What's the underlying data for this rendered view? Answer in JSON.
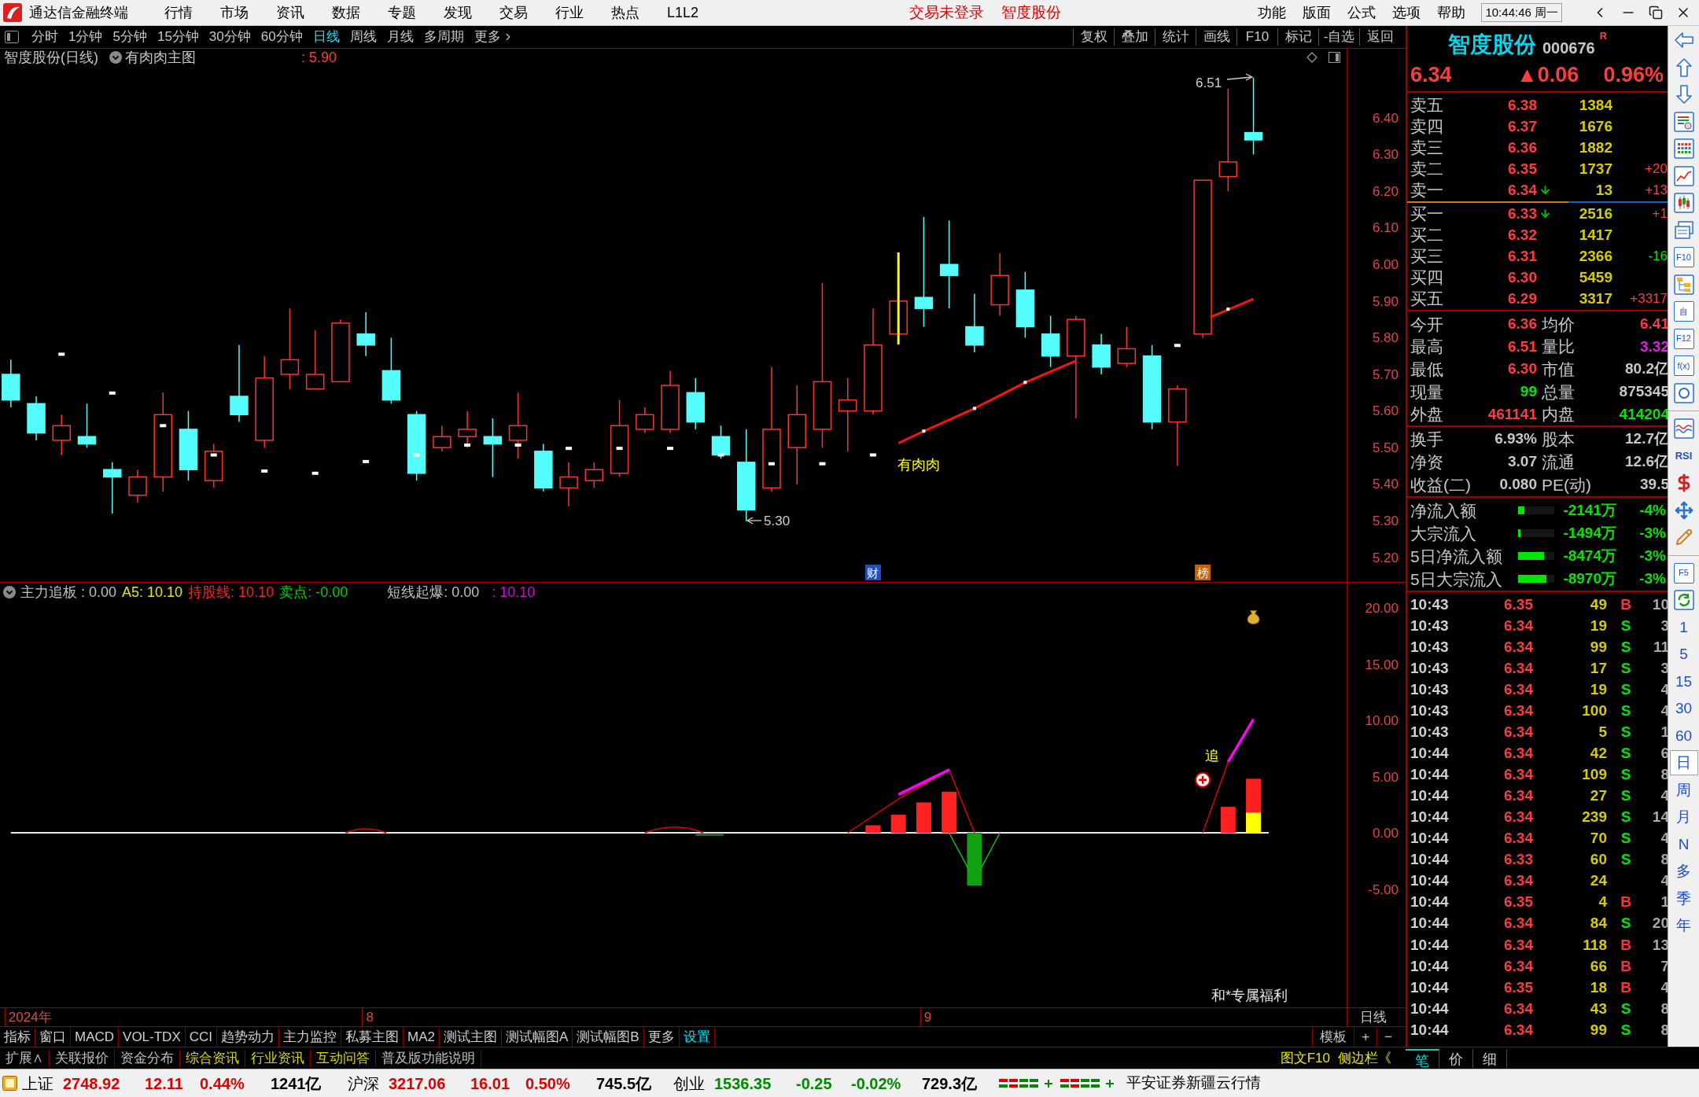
{
  "menu_bar": {
    "app_title": "通达信金融终端",
    "menus": [
      "行情",
      "市场",
      "资讯",
      "数据",
      "专题",
      "发现",
      "交易",
      "行业",
      "热点",
      "L1L2"
    ],
    "notices": [
      "交易未登录",
      "智度股份"
    ],
    "right_menus": [
      "功能",
      "版面",
      "公式",
      "选项",
      "帮助"
    ],
    "clock": "10:44:46 周一"
  },
  "period_bar": {
    "periods": [
      {
        "label": "分时",
        "selected": false,
        "kind": "period"
      },
      {
        "label": "1分钟",
        "selected": false,
        "kind": "period"
      },
      {
        "label": "5分钟",
        "selected": false,
        "kind": "period"
      },
      {
        "label": "15分钟",
        "selected": false,
        "kind": "period"
      },
      {
        "label": "30分钟",
        "selected": false,
        "kind": "period"
      },
      {
        "label": "60分钟",
        "selected": false,
        "kind": "period"
      },
      {
        "label": "日线",
        "selected": true,
        "kind": "period"
      },
      {
        "label": "周线",
        "selected": false,
        "kind": "period"
      },
      {
        "label": "月线",
        "selected": false,
        "kind": "period"
      },
      {
        "label": "多周期",
        "selected": false,
        "kind": "period"
      },
      {
        "label": "更多",
        "selected": false,
        "kind": "menu"
      }
    ],
    "tools": [
      "复权",
      "叠加",
      "统计",
      "画线",
      "F10",
      "标记",
      "-自选",
      "返回"
    ]
  },
  "main_chart": {
    "title": "智度股份(日线)",
    "template": "有肉肉主图",
    "reading": ": 5.90",
    "price_axis": [
      "6.40",
      "6.30",
      "6.20",
      "6.10",
      "6.00",
      "5.90",
      "5.80",
      "5.70",
      "5.60",
      "5.50",
      "5.40",
      "5.30",
      "5.20"
    ],
    "high_label": "6.51",
    "low_label": "5.30",
    "line_label": "有肉肉",
    "markers": [
      {
        "text": "财",
        "kind": "finance"
      },
      {
        "text": "榜",
        "kind": "ranking"
      }
    ]
  },
  "indicator_chart": {
    "readings": [
      {
        "text": "主力追板 : 0.00",
        "color": "#c0c0c0"
      },
      {
        "text": "A5: 10.10",
        "color": "#e6e600"
      },
      {
        "text": "持股线: 10.10",
        "color": "#ff2020"
      },
      {
        "text": "卖点: -0.00",
        "color": "#00d000"
      },
      {
        "text": "短线起爆: 0.00",
        "color": "#c0c0c0"
      },
      {
        "text": ": 10.10",
        "color": "#e000e0"
      }
    ],
    "axis": [
      "20.00",
      "15.00",
      "10.00",
      "5.00",
      "0.00",
      "-5.00"
    ],
    "signal": "追",
    "promo": "和*专属福利"
  },
  "date_axis": {
    "labels": [
      "2024年",
      "8",
      "9"
    ],
    "period": "日线"
  },
  "toolbar": {
    "tabs": [
      {
        "label": "指标",
        "selected": false
      },
      {
        "label": "窗口",
        "selected": false
      },
      {
        "label": "MACD",
        "selected": false
      },
      {
        "label": "VOL-TDX",
        "selected": false
      },
      {
        "label": "CCI",
        "selected": false
      },
      {
        "label": "趋势动力",
        "selected": false
      },
      {
        "label": "主力监控",
        "selected": false
      },
      {
        "label": "私募主图",
        "selected": false
      },
      {
        "label": "MA2",
        "selected": false
      },
      {
        "label": "测试主图",
        "selected": false
      },
      {
        "label": "测试幅图A",
        "selected": false
      },
      {
        "label": "测试幅图B",
        "selected": false
      },
      {
        "label": "更多",
        "selected": false
      },
      {
        "label": "设置",
        "selected": true
      }
    ],
    "tools": [
      "模板",
      "+",
      "−"
    ]
  },
  "info_bar": {
    "links": [
      {
        "label": "扩展∧",
        "color": "#c0c0c0"
      },
      {
        "label": "关联报价",
        "color": "#c0c0c0"
      },
      {
        "label": "资金分布",
        "color": "#c0c0c0"
      },
      {
        "label": "综合资讯",
        "color": "#d8d800"
      },
      {
        "label": "行业资讯",
        "color": "#d8d800"
      },
      {
        "label": "互动问答",
        "color": "#d8d800"
      },
      {
        "label": "普及版功能说明",
        "color": "#c0c0c0"
      }
    ],
    "side_links": [
      "图文F10",
      "侧边栏《"
    ],
    "quote_tabs": [
      {
        "label": "笔",
        "selected": true
      },
      {
        "label": "价",
        "selected": false
      },
      {
        "label": "细",
        "selected": false
      }
    ]
  },
  "status_bar": {
    "indices": [
      {
        "name": "上证",
        "value": "2748.92",
        "change": "12.11",
        "percent": "0.44%",
        "amount": "1241亿",
        "rising": true
      },
      {
        "name": "沪深",
        "value": "3217.06",
        "change": "16.01",
        "percent": "0.50%",
        "amount": "745.5亿",
        "rising": true
      },
      {
        "name": "创业",
        "value": "1536.35",
        "change": "-0.25",
        "percent": "-0.02%",
        "amount": "729.3亿",
        "rising": false
      }
    ],
    "broker": "平安证券新疆云行情"
  },
  "quote_panel": {
    "name": "智度股份",
    "code": "000676",
    "flag": "R",
    "price": "6.34",
    "change": "▲0.06",
    "percent": "0.96%",
    "asks": [
      {
        "label": "卖五",
        "price": "6.38",
        "volume": "1384",
        "arrow_down": false
      },
      {
        "label": "卖四",
        "price": "6.37",
        "volume": "1676",
        "arrow_down": false
      },
      {
        "label": "卖三",
        "price": "6.36",
        "volume": "1882",
        "arrow_down": false
      },
      {
        "label": "卖二",
        "price": "6.35",
        "volume": "1737",
        "arrow_down": false,
        "delta": {
          "text": "+20",
          "rising": true
        }
      },
      {
        "label": "卖一",
        "price": "6.34",
        "volume": "13",
        "arrow_down": true,
        "delta": {
          "text": "+13",
          "rising": true
        }
      }
    ],
    "bids": [
      {
        "label": "买一",
        "price": "6.33",
        "volume": "2516",
        "arrow_down": true,
        "delta": {
          "text": "+1",
          "rising": true
        }
      },
      {
        "label": "买二",
        "price": "6.32",
        "volume": "1417",
        "arrow_down": false
      },
      {
        "label": "买三",
        "price": "6.31",
        "volume": "2366",
        "arrow_down": false,
        "delta": {
          "text": "-16",
          "rising": false
        }
      },
      {
        "label": "买四",
        "price": "6.30",
        "volume": "5459",
        "arrow_down": false
      },
      {
        "label": "买五",
        "price": "6.29",
        "volume": "3317",
        "arrow_down": false,
        "delta": {
          "text": "+3317",
          "rising": true
        }
      }
    ],
    "stats": [
      [
        {
          "label": "今开",
          "value": "6.36",
          "color": "#ff3c3c"
        },
        {
          "label": "均价",
          "value": "6.41",
          "color": "#ff3c3c"
        }
      ],
      [
        {
          "label": "最高",
          "value": "6.51",
          "color": "#ff3c3c"
        },
        {
          "label": "量比",
          "value": "3.32",
          "color": "#e020e0"
        }
      ],
      [
        {
          "label": "最低",
          "value": "6.30",
          "color": "#ff3c3c"
        },
        {
          "label": "市值",
          "value": "80.2亿",
          "color": "#c8c8c8"
        }
      ],
      [
        {
          "label": "现量",
          "value": "99",
          "color": "#00e600"
        },
        {
          "label": "总量",
          "value": "875345",
          "color": "#c8c8c8"
        }
      ],
      [
        {
          "label": "外盘",
          "value": "461141",
          "color": "#ff3c3c"
        },
        {
          "label": "内盘",
          "value": "414204",
          "color": "#00e600"
        }
      ]
    ],
    "fundamentals": [
      [
        {
          "label": "换手",
          "value": "6.93%"
        },
        {
          "label": "股本",
          "value": "12.7亿"
        }
      ],
      [
        {
          "label": "净资",
          "value": "3.07"
        },
        {
          "label": "流通",
          "value": "12.6亿"
        }
      ],
      [
        {
          "label": "收益(二)",
          "value": "0.080"
        },
        {
          "label": "PE(动)",
          "value": "39.5"
        }
      ]
    ],
    "flows": [
      {
        "label": "净流入额",
        "level": 0.17,
        "value": "-2141万",
        "percent": "-4%"
      },
      {
        "label": "大宗流入",
        "level": 0.07,
        "value": "-1494万",
        "percent": "-3%"
      },
      {
        "label": "5日净流入额",
        "level": 0.72,
        "value": "-8474万",
        "percent": "-3%"
      },
      {
        "label": "5日大宗流入",
        "level": 0.78,
        "value": "-8970万",
        "percent": "-3%"
      }
    ],
    "ticks": [
      {
        "time": "10:43",
        "price": "6.35",
        "volume": "49",
        "side": "B",
        "buy": true,
        "count": "10"
      },
      {
        "time": "10:43",
        "price": "6.34",
        "volume": "19",
        "side": "S",
        "buy": false,
        "count": "3"
      },
      {
        "time": "10:43",
        "price": "6.34",
        "volume": "99",
        "side": "S",
        "buy": false,
        "count": "11"
      },
      {
        "time": "10:43",
        "price": "6.34",
        "volume": "17",
        "side": "S",
        "buy": false,
        "count": "3"
      },
      {
        "time": "10:43",
        "price": "6.34",
        "volume": "19",
        "side": "S",
        "buy": false,
        "count": "4"
      },
      {
        "time": "10:43",
        "price": "6.34",
        "volume": "100",
        "side": "S",
        "buy": false,
        "count": "4"
      },
      {
        "time": "10:43",
        "price": "6.34",
        "volume": "5",
        "side": "S",
        "buy": false,
        "count": "1"
      },
      {
        "time": "10:44",
        "price": "6.34",
        "volume": "42",
        "side": "S",
        "buy": false,
        "count": "6"
      },
      {
        "time": "10:44",
        "price": "6.34",
        "volume": "109",
        "side": "S",
        "buy": false,
        "count": "8"
      },
      {
        "time": "10:44",
        "price": "6.34",
        "volume": "27",
        "side": "S",
        "buy": false,
        "count": "4"
      },
      {
        "time": "10:44",
        "price": "6.34",
        "volume": "239",
        "side": "S",
        "buy": false,
        "count": "14"
      },
      {
        "time": "10:44",
        "price": "6.34",
        "volume": "70",
        "side": "S",
        "buy": false,
        "count": "4"
      },
      {
        "time": "10:44",
        "price": "6.33",
        "volume": "60",
        "side": "S",
        "buy": false,
        "count": "8"
      },
      {
        "time": "10:44",
        "price": "6.34",
        "volume": "24",
        "count": "4"
      },
      {
        "time": "10:44",
        "price": "6.35",
        "volume": "4",
        "side": "B",
        "buy": true,
        "count": "1"
      },
      {
        "time": "10:44",
        "price": "6.34",
        "volume": "84",
        "side": "S",
        "buy": false,
        "count": "20"
      },
      {
        "time": "10:44",
        "price": "6.34",
        "volume": "118",
        "side": "B",
        "buy": true,
        "count": "13"
      },
      {
        "time": "10:44",
        "price": "6.34",
        "volume": "66",
        "side": "B",
        "buy": true,
        "count": "7"
      },
      {
        "time": "10:44",
        "price": "6.35",
        "volume": "18",
        "side": "B",
        "buy": true,
        "count": "4"
      },
      {
        "time": "10:44",
        "price": "6.34",
        "volume": "43",
        "side": "S",
        "buy": false,
        "count": "8"
      },
      {
        "time": "10:44",
        "price": "6.34",
        "volume": "99",
        "side": "S",
        "buy": false,
        "count": "8"
      }
    ]
  },
  "side_tools": [
    {
      "kind": "arrow-left"
    },
    {
      "kind": "arrow-up"
    },
    {
      "kind": "arrow-down"
    },
    {
      "kind": "report"
    },
    {
      "kind": "grid"
    },
    {
      "kind": "line"
    },
    {
      "kind": "candles"
    },
    {
      "kind": "windows"
    },
    {
      "kind": "tile",
      "text": "F10"
    },
    {
      "kind": "tree"
    },
    {
      "kind": "tile",
      "text": "自"
    },
    {
      "kind": "tile",
      "text": "F12"
    },
    {
      "kind": "tile",
      "text": "f(x)"
    },
    {
      "kind": "circle"
    },
    {
      "kind": "divider"
    },
    {
      "kind": "wave"
    },
    {
      "kind": "label",
      "text": "RSI"
    },
    {
      "kind": "dollar"
    },
    {
      "kind": "move"
    },
    {
      "kind": "pencil"
    },
    {
      "kind": "divider"
    },
    {
      "kind": "tile",
      "text": "F5"
    },
    {
      "kind": "refresh"
    }
  ],
  "side_periods": [
    {
      "label": "1",
      "selected": false
    },
    {
      "label": "5",
      "selected": false
    },
    {
      "label": "15",
      "selected": false
    },
    {
      "label": "30",
      "selected": false
    },
    {
      "label": "60",
      "selected": false
    },
    {
      "label": "日",
      "selected": true
    },
    {
      "label": "周",
      "selected": false
    },
    {
      "label": "月",
      "selected": false
    },
    {
      "label": "N",
      "selected": false
    },
    {
      "label": "多",
      "selected": false
    },
    {
      "label": "季",
      "selected": false
    },
    {
      "label": "年",
      "selected": false
    }
  ]
}
